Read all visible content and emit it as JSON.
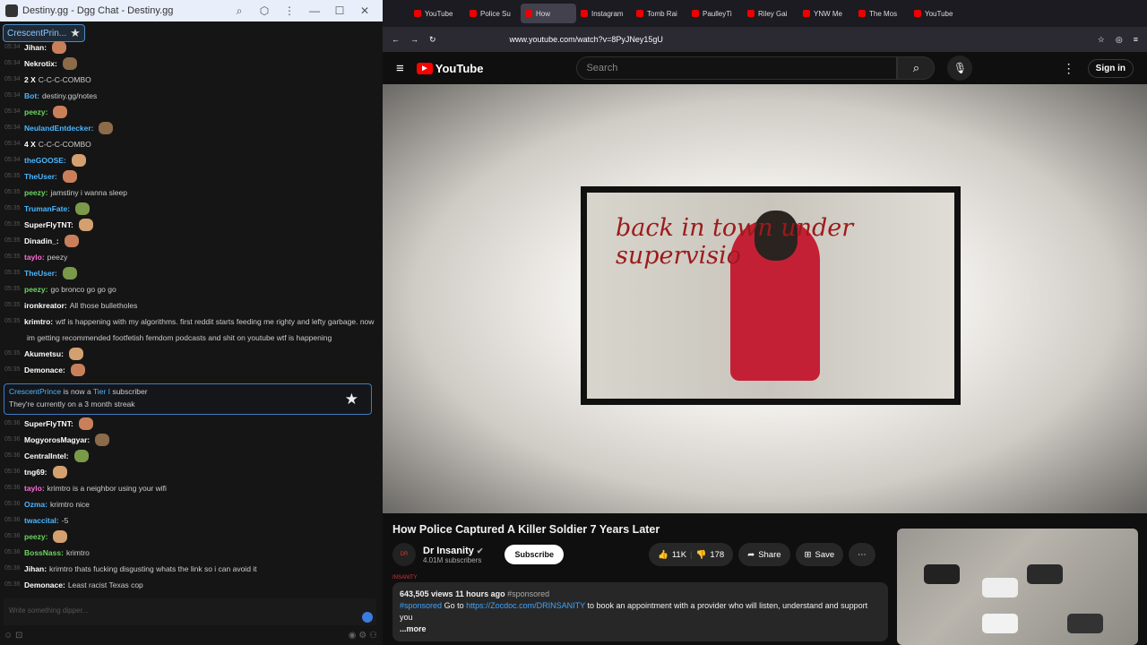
{
  "left_window": {
    "title": "Destiny.gg - Dgg Chat - Destiny.gg",
    "pinned_user": "CrescentPrin...",
    "chat_lines": [
      {
        "ts": "05:34",
        "name": "Jihan:",
        "name_color": "#ffffff",
        "text": ""
      },
      {
        "ts": "05:34",
        "name": "Nekrotix:",
        "name_color": "#ffffff",
        "text": ""
      },
      {
        "ts": "05:34",
        "name": "2 X",
        "name_color": "#ffffff",
        "text": "C-C-C-COMBO"
      },
      {
        "ts": "05:34",
        "name": "Bot:",
        "name_color": "#4bb6ff",
        "text": "destiny.gg/notes"
      },
      {
        "ts": "05:34",
        "name": "peezy:",
        "name_color": "#6ad65f",
        "text": ""
      },
      {
        "ts": "05:34",
        "name": "NeulandEntdecker:",
        "name_color": "#4bb6ff",
        "text": ""
      },
      {
        "ts": "05:34",
        "name": "4 X",
        "name_color": "#ffffff",
        "text": "C-C-C-COMBO"
      },
      {
        "ts": "05:34",
        "name": "theGOOSE:",
        "name_color": "#4bb6ff",
        "text": ""
      },
      {
        "ts": "05:35",
        "name": "TheUser:",
        "name_color": "#4bb6ff",
        "text": ""
      },
      {
        "ts": "05:35",
        "name": "peezy:",
        "name_color": "#6ad65f",
        "text": "jamstiny i wanna sleep"
      },
      {
        "ts": "05:35",
        "name": "TrumanFate:",
        "name_color": "#4bb6ff",
        "text": ""
      },
      {
        "ts": "05:35",
        "name": "SuperFlyTNT:",
        "name_color": "#ffffff",
        "text": ""
      },
      {
        "ts": "05:35",
        "name": "Dinadin_:",
        "name_color": "#ffffff",
        "text": ""
      },
      {
        "ts": "05:35",
        "name": "taylo:",
        "name_color": "#ff6bd5",
        "text": "peezy"
      },
      {
        "ts": "05:35",
        "name": "TheUser:",
        "name_color": "#4bb6ff",
        "text": ""
      },
      {
        "ts": "05:35",
        "name": "peezy:",
        "name_color": "#6ad65f",
        "text": "go bronco go go go"
      },
      {
        "ts": "05:35",
        "name": "ironkreator:",
        "name_color": "#ffffff",
        "text": "All those bulletholes"
      },
      {
        "ts": "05:35",
        "name": "krimtro:",
        "name_color": "#ffffff",
        "text": "wtf is happening with my algorithms. first reddit starts feeding me righty and lefty garbage. now"
      },
      {
        "ts": "",
        "name": "",
        "name_color": "#ffffff",
        "text": "im getting recommended footfetish femdom podcasts and shit on youtube        wtf is happening"
      },
      {
        "ts": "05:35",
        "name": "Akumetsu:",
        "name_color": "#ffffff",
        "text": ""
      },
      {
        "ts": "05:35",
        "name": "Demonace:",
        "name_color": "#ffffff",
        "text": ""
      }
    ],
    "sub_notice": {
      "user": "CrescentPrince",
      "mid": "is now a",
      "tier": "Tier I",
      "end": "subscriber",
      "streak": "They're currently on a 3 month streak"
    },
    "chat_lines_2": [
      {
        "ts": "05:36",
        "name": "SuperFlyTNT:",
        "name_color": "#ffffff",
        "text": ""
      },
      {
        "ts": "05:36",
        "name": "MogyorosMagyar:",
        "name_color": "#ffffff",
        "text": ""
      },
      {
        "ts": "05:36",
        "name": "CentralIntel:",
        "name_color": "#ffffff",
        "text": ""
      },
      {
        "ts": "05:36",
        "name": "tng69:",
        "name_color": "#ffffff",
        "text": ""
      },
      {
        "ts": "05:36",
        "name": "taylo:",
        "name_color": "#ff6bd5",
        "text": "krimtro is a neighbor using your wifi"
      },
      {
        "ts": "05:36",
        "name": "Ozma:",
        "name_color": "#4bb6ff",
        "text": "krimtro nice"
      },
      {
        "ts": "05:36",
        "name": "twaccital:",
        "name_color": "#4bb6ff",
        "text": "-5"
      },
      {
        "ts": "05:36",
        "name": "peezy:",
        "name_color": "#6ad65f",
        "text": ""
      },
      {
        "ts": "05:36",
        "name": "BossNass:",
        "name_color": "#6ad65f",
        "text": "krimtro"
      },
      {
        "ts": "05:36",
        "name": "Jihan:",
        "name_color": "#ffffff",
        "text": "krimtro thats fucking disgusting      whats the link so i can avoid it"
      },
      {
        "ts": "05:36",
        "name": "Demonace:",
        "name_color": "#ffffff",
        "text": "Least racist Texas cop"
      }
    ],
    "input_placeholder": "Write something dipper..."
  },
  "browser": {
    "tabs": [
      "YouTube",
      "Police Su",
      "How",
      "Instagram",
      "Tomb Rai",
      "PaulleyTi",
      "Riley Gai",
      "YNW Me",
      "The Mos",
      "YouTube"
    ],
    "url": "www.youtube.com/watch?v=8PyJNey15gU"
  },
  "youtube": {
    "search_placeholder": "Search",
    "sign_in": "Sign in",
    "video_caption": "back in town under supervisio",
    "video_title": "How Police Captured A Killer Soldier 7 Years Later",
    "channel": "Dr Insanity",
    "avatar_text": "DR INSANITY",
    "subscribers": "4.01M subscribers",
    "subscribe": "Subscribe",
    "likes": "11K",
    "dislikes": "178",
    "share": "Share",
    "save": "Save",
    "views": "643,505 views",
    "ago": "11 hours ago",
    "tag": "#sponsored",
    "desc_tag": "#sponsored",
    "desc_go": "Go to",
    "desc_link": "https://Zocdoc.com/DRINSANITY",
    "desc_rest": "to book an appointment with a provider who will listen, understand and support you",
    "more": "...more"
  }
}
